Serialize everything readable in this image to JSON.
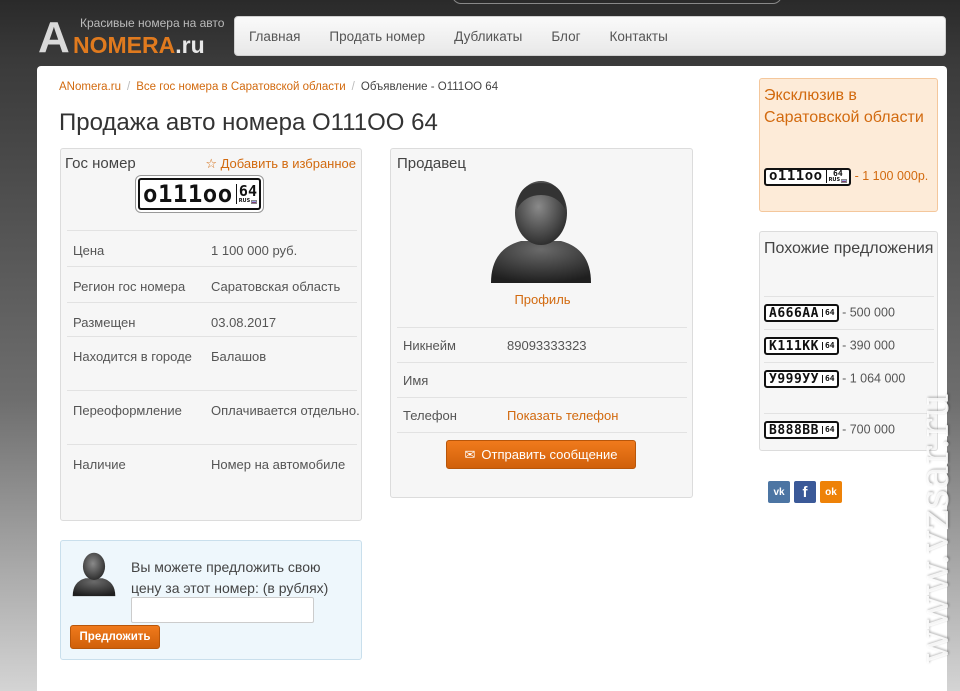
{
  "logo": {
    "tagline": "Красивые номера на авто",
    "a": "A",
    "name": "NOMERA",
    "tld": ".ru"
  },
  "nav": [
    "Главная",
    "Продать номер",
    "Дубликаты",
    "Блог",
    "Контакты"
  ],
  "breadcrumb": {
    "home": "ANomera.ru",
    "section": "Все гос номера в Саратовской области",
    "current": "Объявление - О111ОО 64"
  },
  "title": "Продажа авто номера О111ОО 64",
  "plate_box": {
    "heading": "Гос номер",
    "favorite": "Добавить в избранное",
    "plate": {
      "num": "о111оо",
      "region": "64",
      "rus": "RUS"
    },
    "rows": [
      {
        "k": "Цена",
        "v": "1 100 000 руб."
      },
      {
        "k": "Регион гос номера",
        "v": "Саратовская область"
      },
      {
        "k": "Размещен",
        "v": "03.08.2017"
      },
      {
        "k": "Находится в городе",
        "v": "Балашов"
      },
      {
        "k": "Переоформление",
        "v": "Оплачивается отдельно."
      },
      {
        "k": "Наличие",
        "v": "Номер на автомобиле"
      }
    ]
  },
  "seller": {
    "heading": "Продавец",
    "profile_link": "Профиль",
    "nickname_label": "Никнейм",
    "nickname": "89093333323",
    "name_label": "Имя",
    "name": "",
    "phone_label": "Телефон",
    "phone_link": "Показать телефон",
    "send_button": "Отправить сообщение"
  },
  "offer": {
    "text": "Вы можете предложить свою цену за этот номер: (в рублях)",
    "input_value": "",
    "button": "Предложить"
  },
  "exclusive": {
    "heading": "Эксклюзив в Саратовской области",
    "plate": {
      "num": "о111оо",
      "region": "64",
      "rus": "RUS"
    },
    "price": "- 1 100 000р."
  },
  "similar": {
    "heading": "Похожие предложения",
    "items": [
      {
        "num": "А666АА",
        "region": "64",
        "price": "- 500 000"
      },
      {
        "num": "К111КК",
        "region": "64",
        "price": "- 390 000"
      },
      {
        "num": "У999УУ",
        "region": "64",
        "price": "- 1 064 000"
      },
      {
        "num": "В888ВВ",
        "region": "64",
        "price": "- 700 000"
      }
    ]
  },
  "social": [
    {
      "icon": "vk-icon",
      "label": "vk",
      "color": "#4c75a3"
    },
    {
      "icon": "facebook-icon",
      "label": "f",
      "color": "#3b5998"
    },
    {
      "icon": "odnoklassniki-icon",
      "label": "ok",
      "color": "#ee8208"
    }
  ],
  "watermark": "www.vzsar.ru",
  "colors": {
    "accent": "#d26a0f",
    "button": "#e06d12",
    "exclusive_bg": "#fdebd8",
    "offer_bg": "#eef7fc"
  }
}
